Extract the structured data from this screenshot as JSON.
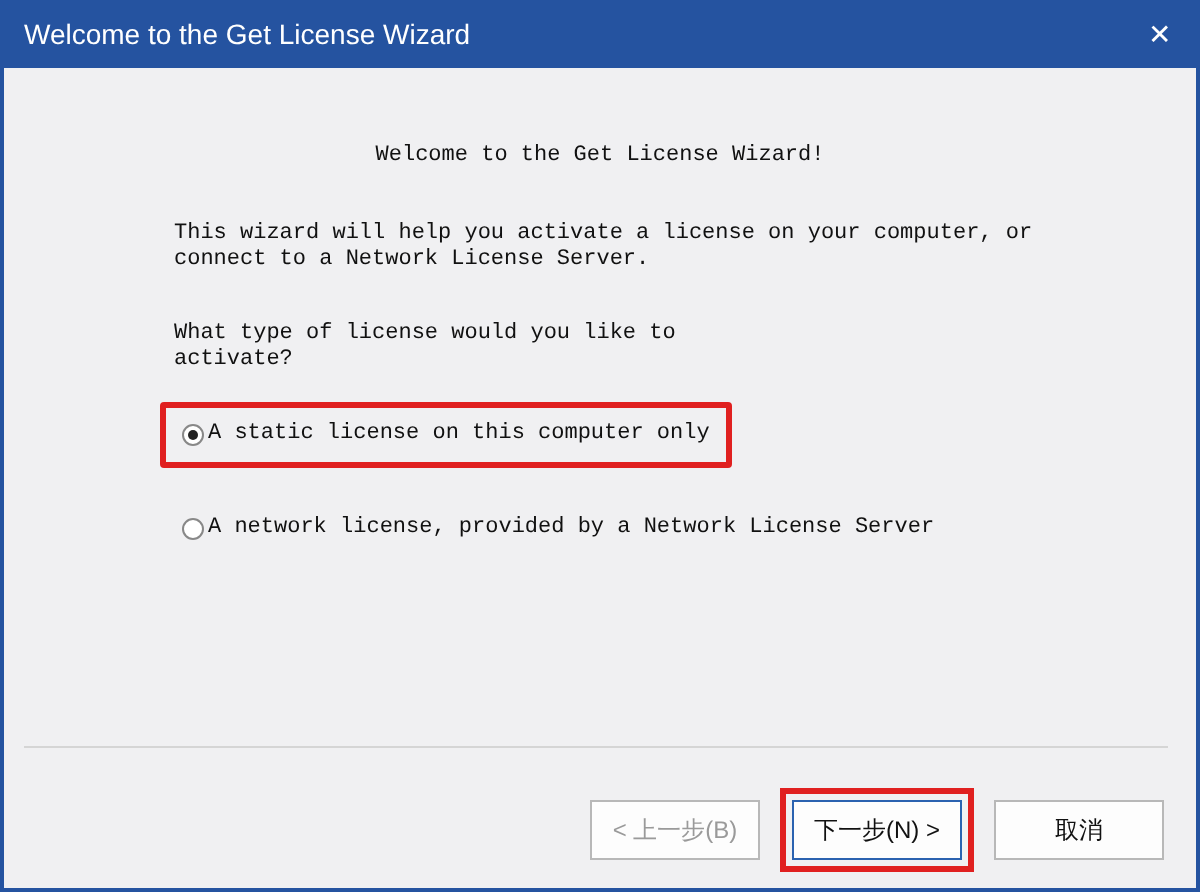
{
  "window": {
    "title": "Welcome to the Get License Wizard",
    "close": "✕"
  },
  "heading": "Welcome to the Get License Wizard!",
  "intro": "This wizard will help you activate a license on your computer, or connect to a Network License Server.",
  "question": "What type of license would you like to activate?",
  "options": [
    {
      "label": "A static license on this computer only",
      "selected": true,
      "highlighted": true
    },
    {
      "label": "A network license, provided by a Network License Server",
      "selected": false,
      "highlighted": false
    }
  ],
  "buttons": [
    {
      "label": "< 上一步(B)",
      "disabled": true,
      "default": false,
      "highlighted": false
    },
    {
      "label": "下一步(N) >",
      "disabled": false,
      "default": true,
      "highlighted": true
    },
    {
      "label": "取消",
      "disabled": false,
      "default": false,
      "highlighted": false
    }
  ]
}
